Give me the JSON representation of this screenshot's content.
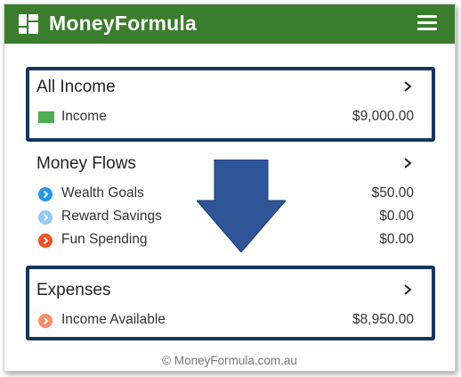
{
  "app": {
    "title": "MoneyFormula",
    "logo_icon": "dashboard-grid-icon",
    "menu_icon": "hamburger-menu-icon",
    "brand_color": "#3a7d2c"
  },
  "sections": {
    "all_income": {
      "title": "All Income",
      "rows": [
        {
          "label": "Income",
          "amount": "$9,000.00",
          "icon": "green-square-icon",
          "color": "#4caf50"
        }
      ]
    },
    "money_flows": {
      "title": "Money Flows",
      "rows": [
        {
          "label": "Wealth Goals",
          "amount": "$50.00",
          "icon": "chevron-circle-icon",
          "color": "#2196f3"
        },
        {
          "label": "Reward Savings",
          "amount": "$0.00",
          "icon": "chevron-circle-icon",
          "color": "#90caf9"
        },
        {
          "label": "Fun Spending",
          "amount": "$0.00",
          "icon": "chevron-circle-icon",
          "color": "#f4511e"
        }
      ]
    },
    "expenses": {
      "title": "Expenses",
      "rows": [
        {
          "label": "Income Available",
          "amount": "$8,950.00",
          "icon": "chevron-circle-icon",
          "color": "#ff8a65"
        }
      ]
    }
  },
  "annotation": {
    "outline_color": "#16355f",
    "arrow_color": "#2e5597",
    "arrow_icon": "down-arrow-icon"
  },
  "footer": {
    "text": "© MoneyFormula.com.au"
  }
}
